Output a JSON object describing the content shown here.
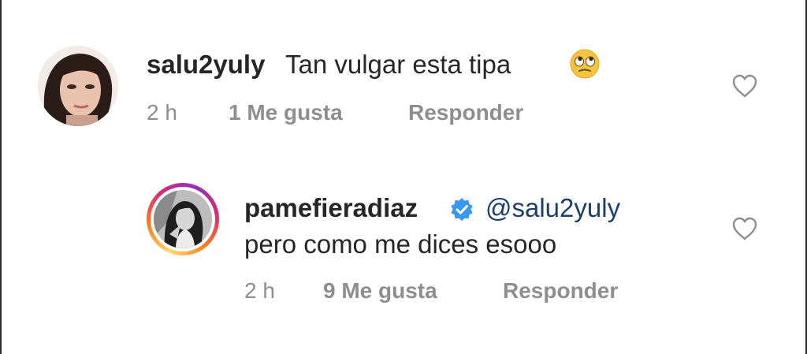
{
  "comments": [
    {
      "username": "salu2yuly",
      "text": "Tan vulgar esta tipa",
      "emoji": "🙄",
      "time": "2 h",
      "likes": "1 Me gusta",
      "reply": "Responder"
    },
    {
      "username": "pamefieradiaz",
      "verified": true,
      "mention": "@salu2yuly",
      "text": "pero como me dices esooo",
      "time": "2 h",
      "likes": "9 Me gusta",
      "reply": "Responder"
    }
  ],
  "colors": {
    "text": "#262626",
    "meta": "#8e8e8e",
    "verified": "#3897f0",
    "mention": "#1c3d6e"
  },
  "icons": {
    "like": "heart-outline-icon",
    "verified": "verified-badge-icon",
    "emoji": "face-with-rolling-eyes-emoji"
  }
}
